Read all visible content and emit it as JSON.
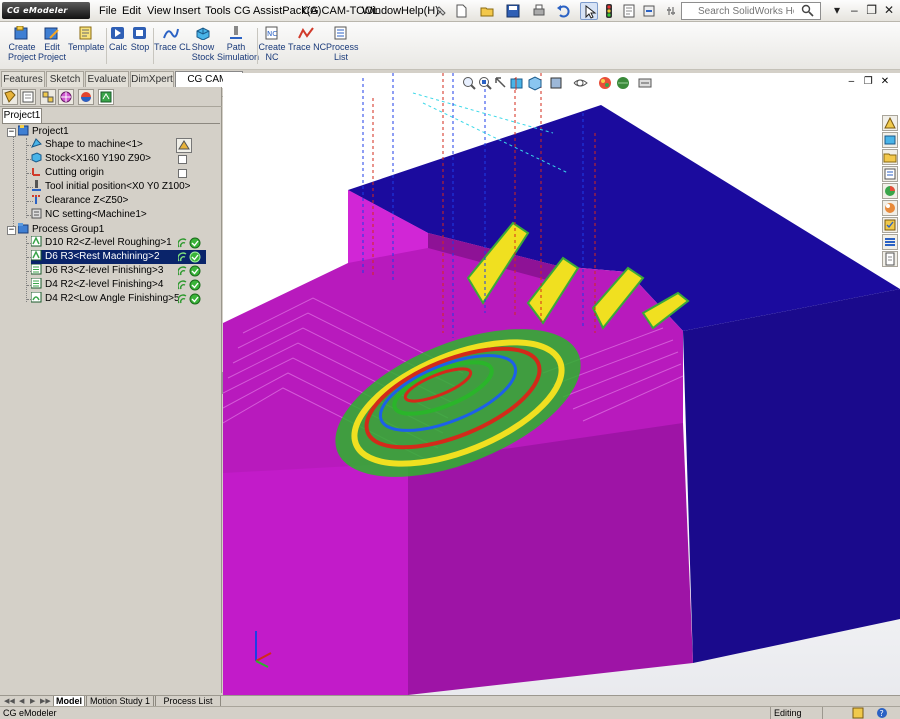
{
  "app": {
    "logo_text": "CG eModeler",
    "menus": [
      "File",
      "Edit",
      "View",
      "Insert",
      "Tools",
      "CG AssistPack(A)",
      "CG CAM-TOOL",
      "Window",
      "Help(H)"
    ],
    "search_placeholder": "Search SolidWorks Help"
  },
  "command_manager": {
    "buttons": [
      {
        "label": "Create\nProject",
        "icon": "create-project-icon"
      },
      {
        "label": "Edit\nProject",
        "icon": "edit-project-icon"
      },
      {
        "label": "Template",
        "icon": "template-icon"
      },
      {
        "label": "Calc",
        "icon": "play-icon"
      },
      {
        "label": "Stop",
        "icon": "stop-icon"
      },
      {
        "label": "Trace CL",
        "icon": "trace-cl-icon"
      },
      {
        "label": "Show\nStock",
        "icon": "show-stock-icon"
      },
      {
        "label": "Path\nSimulation",
        "icon": "path-simulation-icon"
      },
      {
        "label": "Create\nNC",
        "icon": "create-nc-icon"
      },
      {
        "label": "Trace NC",
        "icon": "trace-nc-icon"
      },
      {
        "label": "Process\nList",
        "icon": "process-list-icon"
      }
    ]
  },
  "tabs": [
    "Features",
    "Sketch",
    "Evaluate",
    "DimXpert",
    "CG CAM-TOOL"
  ],
  "active_tab": "CG CAM-TOOL",
  "project_tab": "Project1",
  "tree": {
    "project": "Project1",
    "items": [
      {
        "label": "Shape to machine<1>",
        "icon": "shape-icon"
      },
      {
        "label": "Stock<X160 Y190 Z90>",
        "icon": "stock-icon",
        "checkbox": false
      },
      {
        "label": "Cutting origin",
        "icon": "origin-icon",
        "checkbox": false
      },
      {
        "label": "Tool initial position<X0 Y0 Z100>",
        "icon": "tool-position-icon"
      },
      {
        "label": "Clearance Z<Z50>",
        "icon": "clearance-icon"
      },
      {
        "label": "NC setting<Machine1>",
        "icon": "nc-setting-icon"
      }
    ],
    "group": "Process Group1",
    "processes": [
      {
        "label": "D10 R2<Z-level Roughing>1",
        "selected": false
      },
      {
        "label": "D6 R3<Rest Machining>2",
        "selected": true
      },
      {
        "label": "D6 R3<Z-level Finishing>3",
        "selected": false
      },
      {
        "label": "D4 R2<Z-level Finishing>4",
        "selected": false
      },
      {
        "label": "D4 R2<Low Angle Finishing>5",
        "selected": false
      }
    ]
  },
  "bottom_tabs": [
    "Model",
    "Motion Study 1",
    "Process List"
  ],
  "active_bottom_tab": "Model",
  "status": {
    "left": "CG eModeler",
    "mode": "Editing Part"
  },
  "colors": {
    "stock_top": "#1a0a8c",
    "part_magenta": "#c21bc9",
    "selection": "#0a246a"
  }
}
